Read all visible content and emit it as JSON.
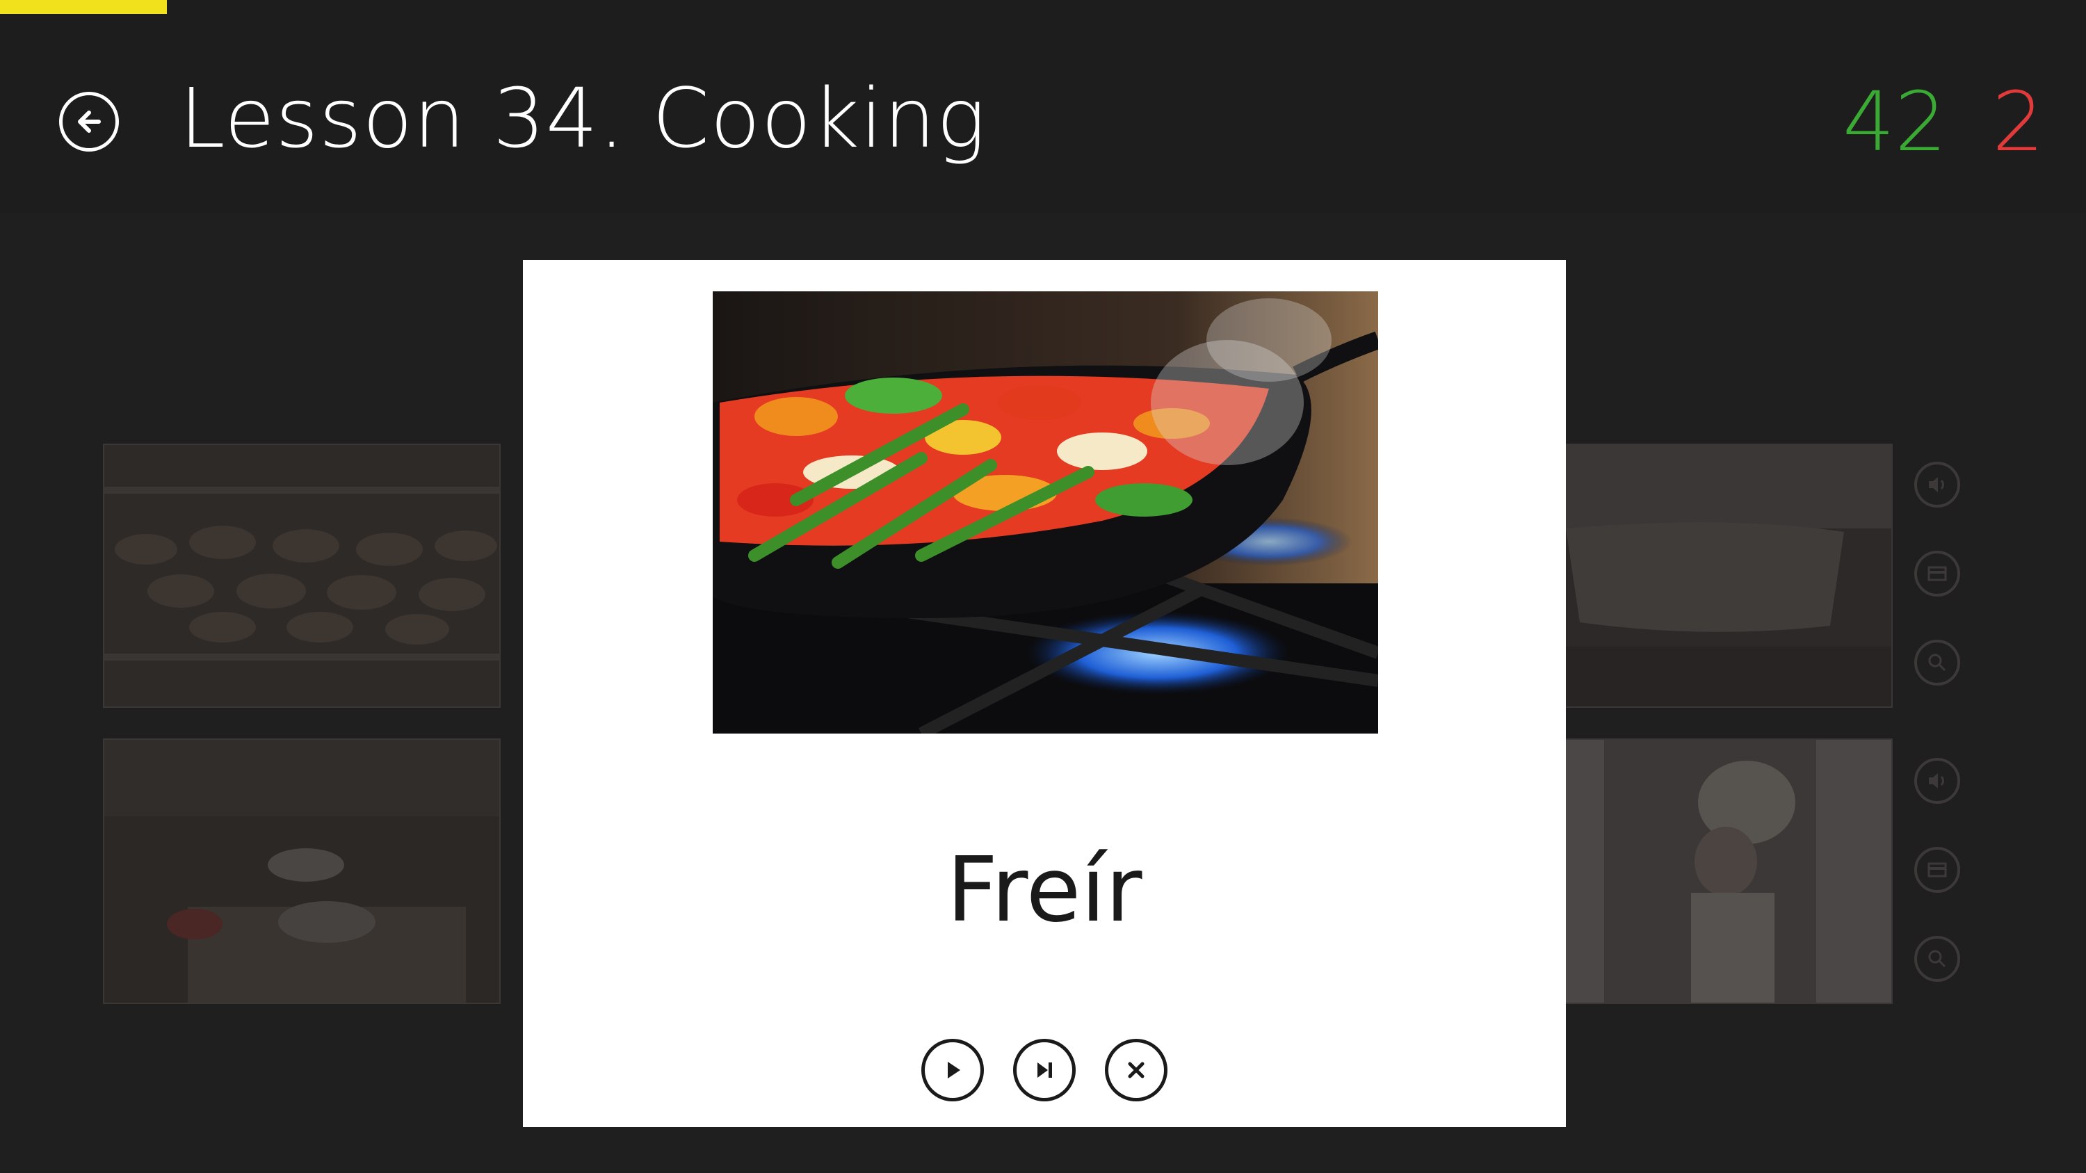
{
  "header": {
    "title": "Lesson 34. Cooking",
    "score_correct": "42",
    "score_wrong": "2"
  },
  "progress": {
    "fraction": 0.08
  },
  "card": {
    "word": "Freír",
    "controls": [
      "play-icon",
      "skip-next-icon",
      "close-icon"
    ]
  },
  "background": {
    "side_icons": [
      "speaker-icon",
      "card-icon",
      "magnify-icon",
      "speaker-icon",
      "card-icon",
      "magnify-icon"
    ]
  },
  "colors": {
    "accent": "#f0e11c",
    "correct": "#3aaa35",
    "wrong": "#e03a3a",
    "background": "#201f1f"
  }
}
